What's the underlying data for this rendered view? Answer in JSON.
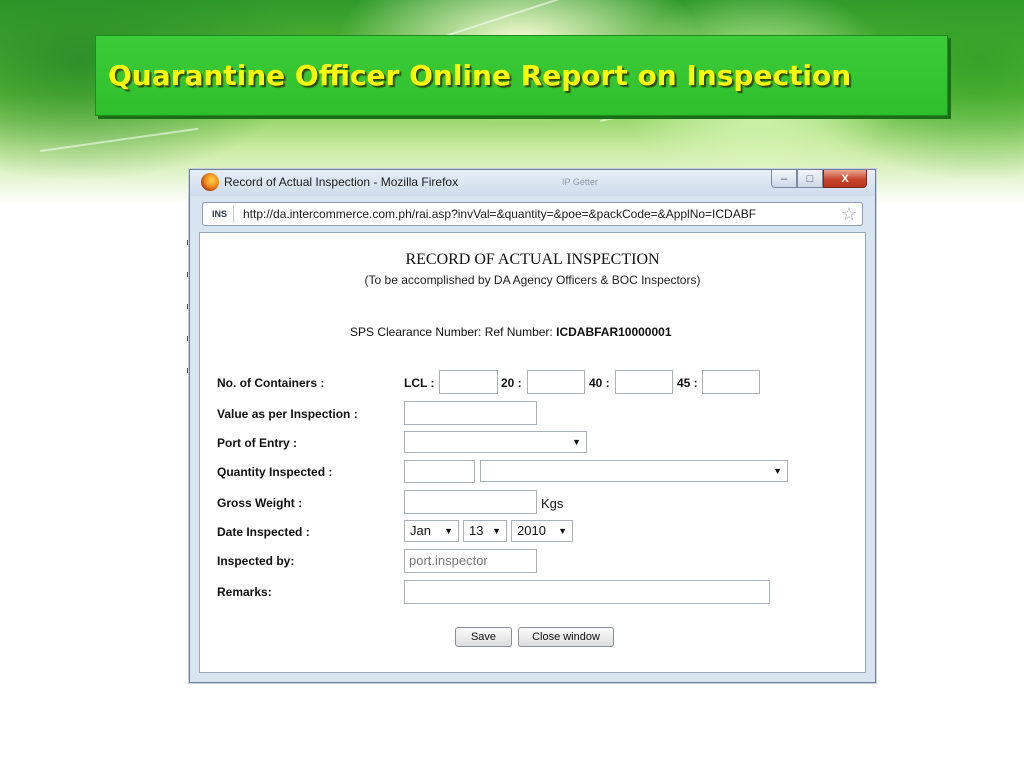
{
  "slide": {
    "title": "Quarantine Officer Online Report on Inspection"
  },
  "window": {
    "title": "Record of Actual Inspection - Mozilla Firefox",
    "ghost_title": "IP Getter",
    "url_badge": "INS",
    "url": "http://da.intercommerce.com.ph/rai.asp?invVal=&quantity=&poe=&packCode=&ApplNo=ICDABF",
    "buttons": {
      "minimize": "–",
      "maximize": "□",
      "close": "X"
    }
  },
  "form": {
    "heading": "RECORD OF ACTUAL INSPECTION",
    "subheading": "(To be accomplished by DA Agency Officers & BOC Inspectors)",
    "sps_label": "SPS Clearance Number:",
    "ref_label": "Ref Number:",
    "ref_number": "ICDABFAR10000001",
    "labels": {
      "containers": "No. of Containers :",
      "value": "Value as per Inspection :",
      "port": "Port of Entry :",
      "quantity": "Quantity Inspected :",
      "weight": "Gross Weight :",
      "date": "Date Inspected :",
      "inspector": "Inspected by:",
      "remarks": "Remarks:"
    },
    "containers": [
      {
        "label": "LCL :",
        "value": ""
      },
      {
        "label": "20 :",
        "value": ""
      },
      {
        "label": "40 :",
        "value": ""
      },
      {
        "label": "45 :",
        "value": ""
      }
    ],
    "value_input": "",
    "port_selected": "",
    "quantity_input": "",
    "quantity_unit_selected": "",
    "weight_input": "",
    "weight_unit": "Kgs",
    "date": {
      "month": "Jan",
      "day": "13",
      "year": "2010"
    },
    "inspector_placeholder": "port.inspector",
    "remarks_input": "",
    "save_label": "Save",
    "close_label": "Close window"
  }
}
